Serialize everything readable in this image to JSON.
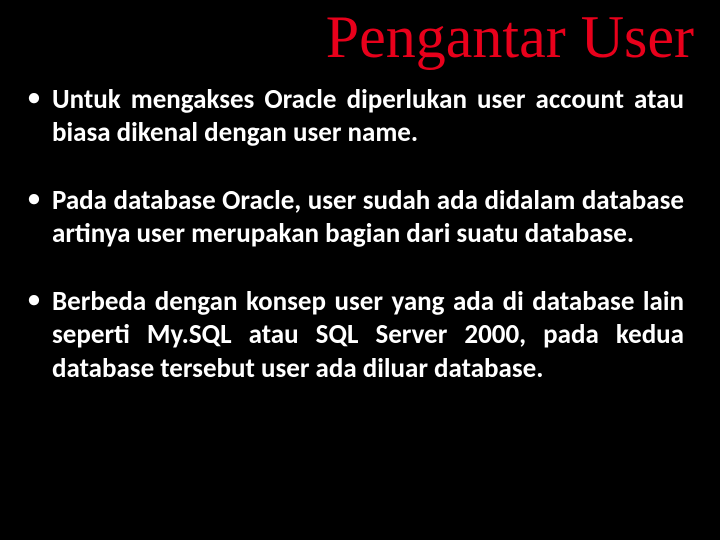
{
  "title": "Pengantar User",
  "bullets": [
    "Untuk   mengakses  Oracle  diperlukan  user account  atau  biasa dikenal dengan user name.",
    "Pada database Oracle, user sudah ada didalam database artinya user merupakan bagian dari suatu database.",
    "Berbeda dengan konsep user yang ada di database lain seperti My.SQL atau SQL Server 2000, pada kedua database tersebut user ada diluar database."
  ]
}
